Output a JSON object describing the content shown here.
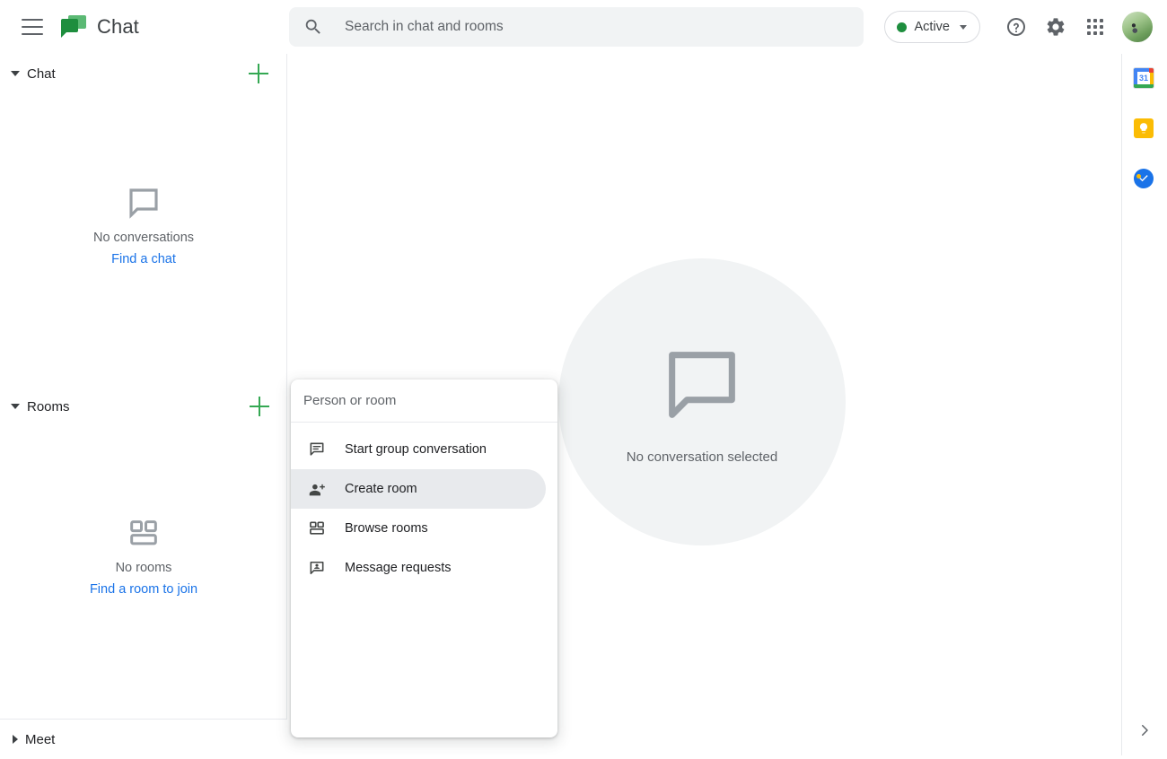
{
  "header": {
    "menu_icon": "hamburger-icon",
    "logo_icon": "google-chat-logo",
    "title": "Chat",
    "search": {
      "icon": "search-icon",
      "placeholder": "Search in chat and rooms",
      "value": ""
    },
    "status": {
      "label": "Active",
      "dot_color": "#1e8e3e",
      "caret": "chevron-down-icon"
    },
    "help_icon": "help-circle-icon",
    "settings_icon": "gear-icon",
    "apps_icon": "apps-grid-icon",
    "avatar": "user-avatar"
  },
  "sidebar": {
    "chat_section": {
      "title": "Chat",
      "expanded": true,
      "add_label": "+",
      "empty": {
        "icon": "speech-bubble-icon",
        "title": "No conversations",
        "link": "Find a chat"
      }
    },
    "rooms_section": {
      "title": "Rooms",
      "expanded": true,
      "add_label": "+",
      "empty": {
        "icon": "rooms-grid-icon",
        "title": "No rooms",
        "link": "Find a room to join"
      }
    },
    "meet_section": {
      "title": "Meet",
      "expanded": false
    }
  },
  "main": {
    "empty_state": {
      "icon": "speech-bubble-icon",
      "caption": "No conversation selected"
    }
  },
  "dropdown": {
    "search": {
      "placeholder": "Person or room",
      "value": ""
    },
    "items": [
      {
        "label": "Start group conversation",
        "icon": "group-chat-icon",
        "active": false
      },
      {
        "label": "Create room",
        "icon": "person-add-icon",
        "active": true
      },
      {
        "label": "Browse rooms",
        "icon": "rooms-grid-icon",
        "active": false
      },
      {
        "label": "Message requests",
        "icon": "message-request-icon",
        "active": false
      }
    ]
  },
  "right_rail": {
    "apps": [
      {
        "name": "Google Calendar",
        "icon": "calendar-icon",
        "badge": "31"
      },
      {
        "name": "Google Keep",
        "icon": "keep-bulb-icon",
        "badge": ""
      },
      {
        "name": "Google Tasks",
        "icon": "tasks-check-icon",
        "badge": ""
      }
    ],
    "expand_icon": "chevron-right-icon"
  },
  "colors": {
    "accent_green": "#34a853",
    "link_blue": "#1a73e8",
    "surface_grey": "#f1f3f4",
    "text_primary": "#202124",
    "text_secondary": "#5f6368"
  }
}
